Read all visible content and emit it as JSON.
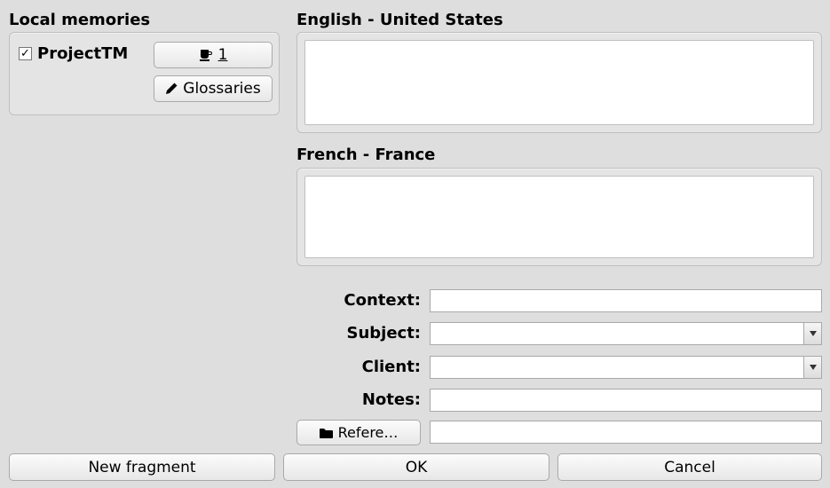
{
  "sidebar": {
    "title": "Local memories",
    "memory_name": "ProjectTM",
    "memory_checked": true,
    "providers_button": "1",
    "glossaries_button": "Glossaries"
  },
  "editor": {
    "source_lang_label": "English - United States",
    "target_lang_label": "French - France",
    "source_text": "",
    "target_text": ""
  },
  "form": {
    "context_label": "Context:",
    "context_value": "",
    "subject_label": "Subject:",
    "subject_value": "",
    "client_label": "Client:",
    "client_value": "",
    "notes_label": "Notes:",
    "notes_value": "",
    "references_button": "Refere…",
    "references_value": ""
  },
  "footer": {
    "new_fragment": "New fragment",
    "ok": "OK",
    "cancel": "Cancel"
  },
  "icons": {
    "checkmark": "✓"
  }
}
